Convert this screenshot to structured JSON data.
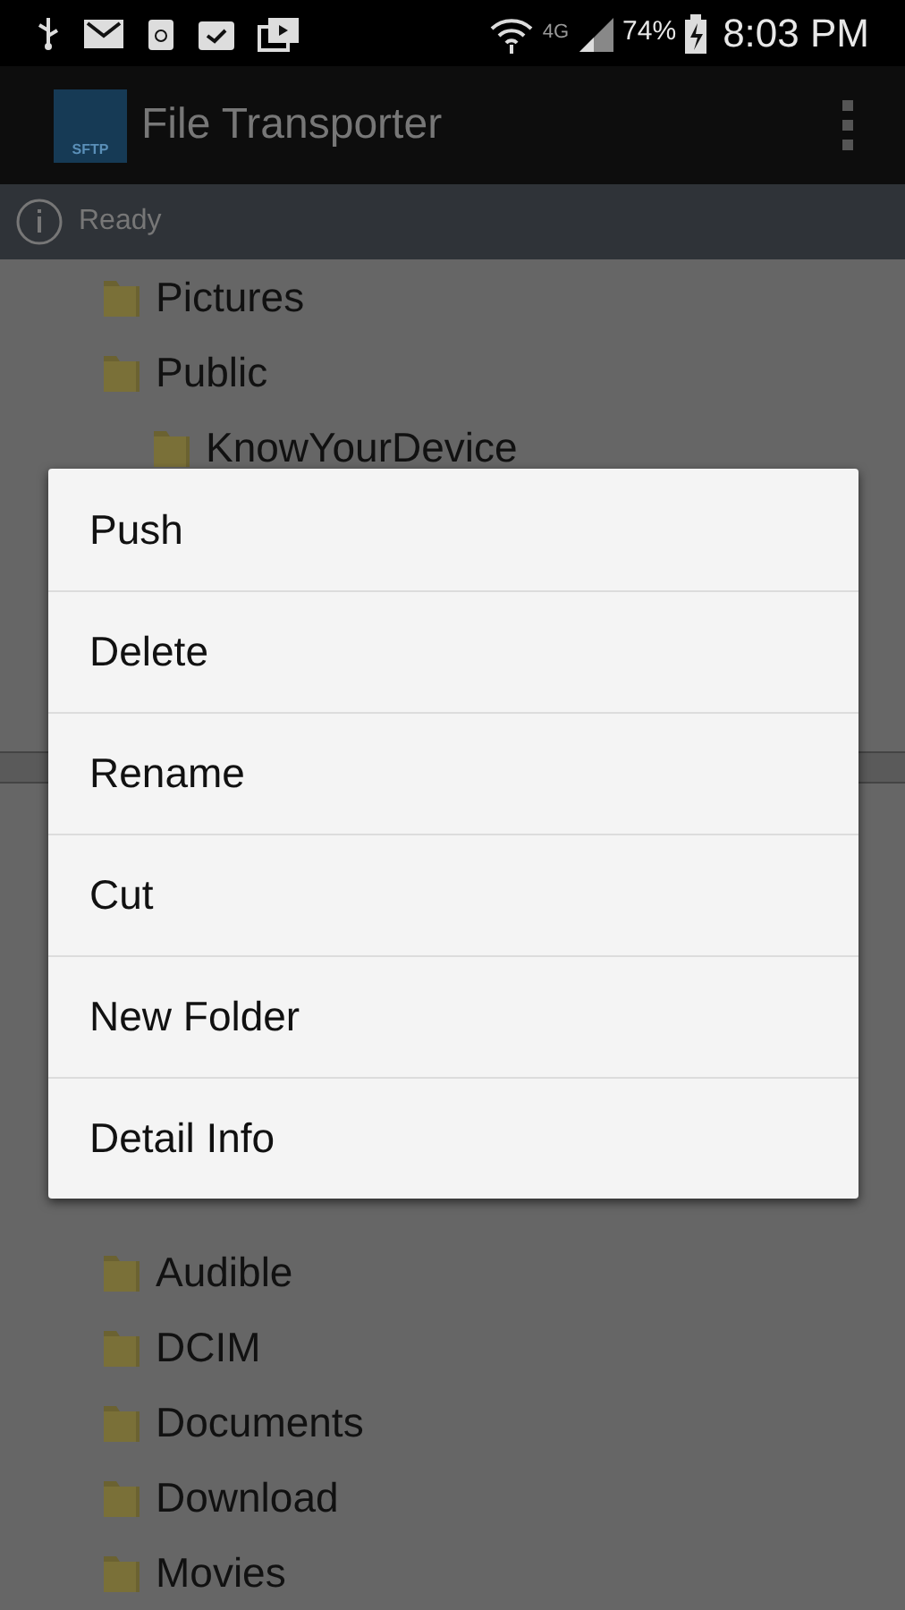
{
  "status_bar": {
    "network": "4G",
    "battery": "74%",
    "time": "8:03 PM"
  },
  "action_bar": {
    "logo_text": "SFTP",
    "title": "File Transporter"
  },
  "status_row": {
    "text": "Ready"
  },
  "remote_tree": [
    {
      "name": "Pictures"
    },
    {
      "name": "Public",
      "children": [
        {
          "name": "KnowYourDevice"
        }
      ]
    }
  ],
  "local_list": [
    {
      "name": "Audible"
    },
    {
      "name": "DCIM"
    },
    {
      "name": "Documents"
    },
    {
      "name": "Download"
    },
    {
      "name": "Movies"
    }
  ],
  "context_menu": {
    "items": [
      "Push",
      "Delete",
      "Rename",
      "Cut",
      "New Folder",
      "Detail Info"
    ]
  }
}
